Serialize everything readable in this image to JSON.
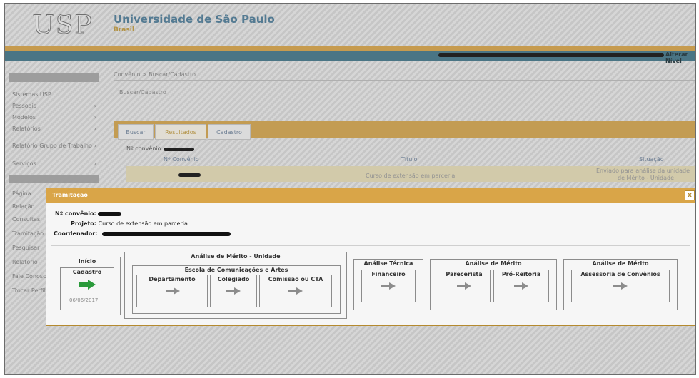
{
  "header": {
    "logo_text": "USP",
    "title": "Universidade de São Paulo",
    "subtitle": "Brasil",
    "user_link": "Alterar Nível"
  },
  "sidebar": {
    "items": [
      {
        "label": "Sistemas USP",
        "arrow": ""
      },
      {
        "label": "Pessoais",
        "arrow": "›"
      },
      {
        "label": "Modelos",
        "arrow": "›"
      },
      {
        "label": "Relatórios",
        "arrow": "›"
      },
      {
        "label": "Relatório Grupo de Trabalho",
        "arrow": "›"
      },
      {
        "label": "Serviços",
        "arrow": "›"
      },
      {
        "label": "Página",
        "arrow": ""
      },
      {
        "label": "Relação",
        "arrow": ""
      },
      {
        "label": "Consultas",
        "arrow": ""
      },
      {
        "label": "Tramitação",
        "arrow": ""
      },
      {
        "label": "Pesquisar",
        "arrow": ""
      },
      {
        "label": "Relatório",
        "arrow": ""
      },
      {
        "label": "Fale Conosco",
        "arrow": ""
      },
      {
        "label": "Trocar Perfil",
        "arrow": ""
      }
    ]
  },
  "content": {
    "breadcrumb": "Convênio > Buscar/Cadastro",
    "subtitle": "Buscar/Cadastro",
    "tabs": [
      {
        "label": "Buscar"
      },
      {
        "label": "Resultados"
      },
      {
        "label": "Cadastro"
      }
    ],
    "nconv_label": "Nº convênio:",
    "columns": [
      "Nº Convênio",
      "Título",
      "Situação"
    ],
    "row": {
      "titulo": "Curso de extensão em parceria",
      "situacao_1": "Enviado para análise da unidade",
      "situacao_2": "de Mérito - Unidade"
    }
  },
  "modal": {
    "title": "Tramitação",
    "close": "x",
    "nconv_label": "Nº convênio:",
    "projeto_label": "Projeto:",
    "projeto_value": "Curso de extensão em parceria",
    "coordenador_label": "Coordenador:",
    "stages": {
      "inicio": "Início",
      "cadastro": "Cadastro",
      "cadastro_date": "06/06/2017",
      "merito_unidade": "Análise de Mérito - Unidade",
      "escola": "Escola de Comunicações e Artes",
      "departamento": "Departamento",
      "colegiado": "Colegiado",
      "comissao": "Comissão ou CTA",
      "tecnica": "Análise Técnica",
      "financeiro": "Financeiro",
      "merito_2": "Análise de Mérito",
      "parecerista": "Parecerista",
      "pro_reitoria": "Pró-Reitoria",
      "merito_3": "Análise de Mérito",
      "assessoria": "Assessoria de Convênios"
    }
  },
  "colors": {
    "orange": "#d9a548",
    "blue_bar": "#42778a",
    "title_blue": "#4d7d9a",
    "arrow_green": "#2a9a3a",
    "arrow_gray": "#8c8c8c"
  }
}
